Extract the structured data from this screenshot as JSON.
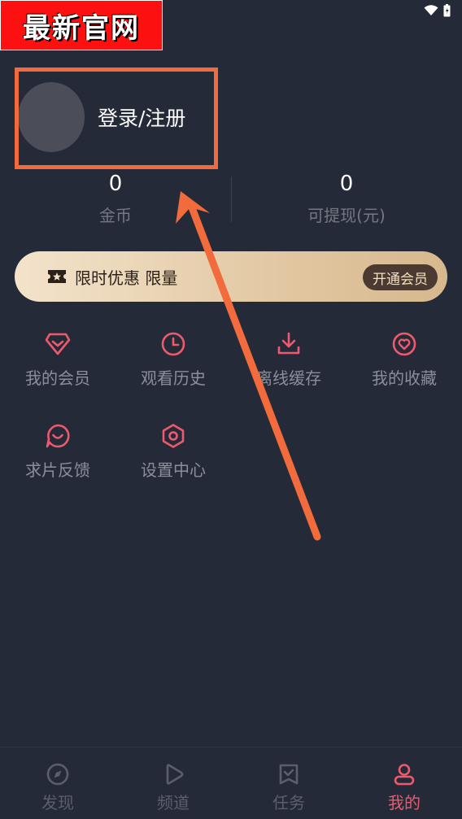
{
  "watermark": {
    "text": "最新官网"
  },
  "profile": {
    "login_label": "登录/注册"
  },
  "stats": [
    {
      "value": "0",
      "label": "金币"
    },
    {
      "value": "0",
      "label": "可提现(元)"
    }
  ],
  "vip": {
    "promo_text": "限时优惠 限量",
    "button_label": "开通会员"
  },
  "menu": [
    {
      "label": "我的会员",
      "icon": "diamond-icon"
    },
    {
      "label": "观看历史",
      "icon": "clock-icon"
    },
    {
      "label": "离线缓存",
      "icon": "download-icon"
    },
    {
      "label": "我的收藏",
      "icon": "heart-icon"
    },
    {
      "label": "求片反馈",
      "icon": "chat-smile-icon"
    },
    {
      "label": "设置中心",
      "icon": "hexagon-settings-icon"
    }
  ],
  "tabs": [
    {
      "label": "发现",
      "icon": "compass-icon",
      "active": false
    },
    {
      "label": "频道",
      "icon": "play-icon",
      "active": false
    },
    {
      "label": "任务",
      "icon": "task-icon",
      "active": false
    },
    {
      "label": "我的",
      "icon": "user-icon",
      "active": true
    }
  ],
  "colors": {
    "background": "#252a39",
    "accent": "#ee5a6d",
    "annotation": "#f26b3c"
  }
}
